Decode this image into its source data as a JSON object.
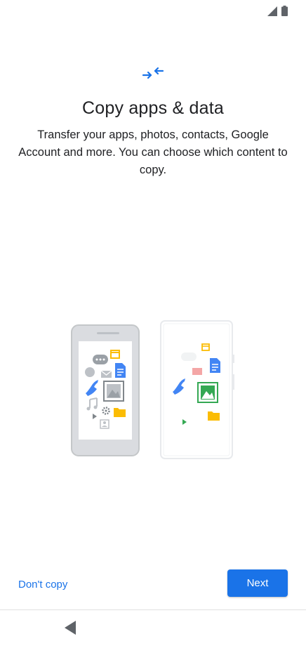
{
  "status_bar": {
    "icons": [
      "signal-icon",
      "battery-icon"
    ]
  },
  "header": {
    "icon": "transfer-arrows-icon",
    "title": "Copy apps & data",
    "description": "Transfer your apps, photos, contacts, Google Account and more. You can choose which content to copy."
  },
  "illustration": {
    "icons": [
      "old-phone-icon",
      "new-phone-icon",
      "message-icon",
      "calendar-icon",
      "document-icon",
      "mail-icon",
      "phone-call-icon",
      "photo-icon",
      "music-icon",
      "settings-icon",
      "folder-icon",
      "play-icon",
      "contact-icon"
    ]
  },
  "actions": {
    "dont_copy_label": "Don't copy",
    "next_label": "Next"
  },
  "nav_bar": {
    "icon": "back-icon"
  },
  "colors": {
    "accent": "#1a73e8",
    "text": "#202124",
    "green": "#34a853",
    "yellow": "#fbbc04",
    "red": "#ea4335"
  }
}
